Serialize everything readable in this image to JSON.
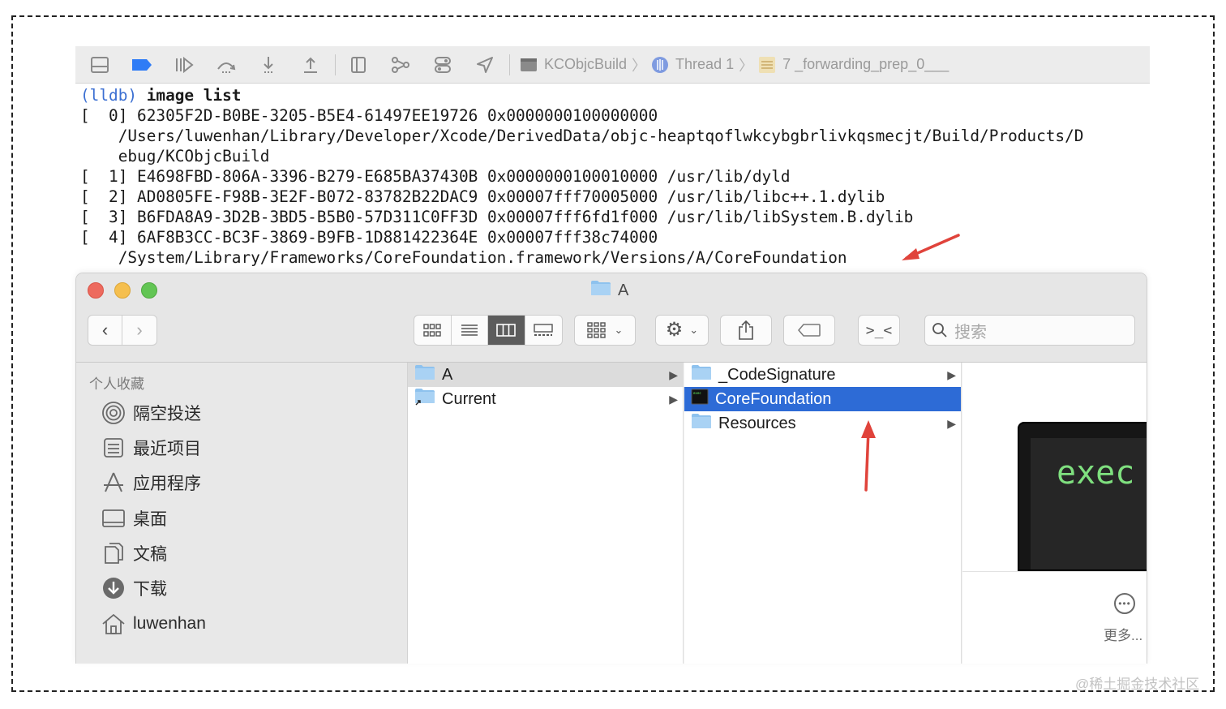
{
  "xcode": {
    "breadcrumbs": [
      {
        "label": "KCObjcBuild",
        "icon": "app-target-icon"
      },
      {
        "label": "Thread 1",
        "icon": "thread-icon"
      },
      {
        "label": "7 _forwarding_prep_0___",
        "icon": "stack-frame-icon"
      }
    ],
    "toolbar_icons": [
      "hide-debug-area-icon",
      "breakpoints-toggle-icon",
      "continue-icon",
      "step-over-icon",
      "step-into-icon",
      "step-out-icon",
      "debug-view-hierarchy-icon",
      "memory-graph-icon",
      "environment-overrides-icon",
      "simulate-location-icon"
    ]
  },
  "console": {
    "prompt": "(lldb)",
    "command": "image list",
    "lines": [
      "[  0] 62305F2D-B0BE-3205-B5E4-61497EE19726 0x0000000100000000",
      "    /Users/luwenhan/Library/Developer/Xcode/DerivedData/objc-heaptqoflwkcybgbrlivkqsmecjt/Build/Products/D",
      "    ebug/KCObjcBuild",
      "[  1] E4698FBD-806A-3396-B279-E685BA37430B 0x0000000100010000 /usr/lib/dyld",
      "[  2] AD0805FE-F98B-3E2F-B072-83782B22DAC9 0x00007fff70005000 /usr/lib/libc++.1.dylib",
      "[  3] B6FDA8A9-3D2B-3BD5-B5B0-57D311C0FF3D 0x00007fff6fd1f000 /usr/lib/libSystem.B.dylib",
      "[  4] 6AF8B3CC-BC3F-3869-B9FB-1D881422364E 0x00007fff38c74000",
      "    /System/Library/Frameworks/CoreFoundation.framework/Versions/A/CoreFoundation"
    ]
  },
  "finder": {
    "title": "A",
    "search_placeholder": "搜索",
    "sidebar": {
      "header": "个人收藏",
      "items": [
        {
          "label": "隔空投送",
          "icon": "airdrop-icon"
        },
        {
          "label": "最近项目",
          "icon": "recents-icon"
        },
        {
          "label": "应用程序",
          "icon": "applications-icon"
        },
        {
          "label": "桌面",
          "icon": "desktop-icon"
        },
        {
          "label": "文稿",
          "icon": "documents-icon"
        },
        {
          "label": "下载",
          "icon": "downloads-icon"
        },
        {
          "label": "luwenhan",
          "icon": "home-icon"
        }
      ]
    },
    "column1": [
      {
        "label": "A",
        "has_children": true,
        "selected": "inactive"
      },
      {
        "label": "Current",
        "has_children": true,
        "alias": true
      }
    ],
    "column2": [
      {
        "label": "_CodeSignature",
        "has_children": true
      },
      {
        "label": "CoreFoundation",
        "has_children": false,
        "selected": "active"
      },
      {
        "label": "Resources",
        "has_children": true
      }
    ],
    "preview": {
      "exec_label": "exec",
      "more_label": "更多..."
    }
  },
  "watermark": "@稀土掘金技术社区",
  "colors": {
    "selection_blue": "#2d6bd6",
    "annotation_red": "#e0433b",
    "lldb_prompt": "#3b6fd2",
    "exec_green": "#7fe07f"
  }
}
